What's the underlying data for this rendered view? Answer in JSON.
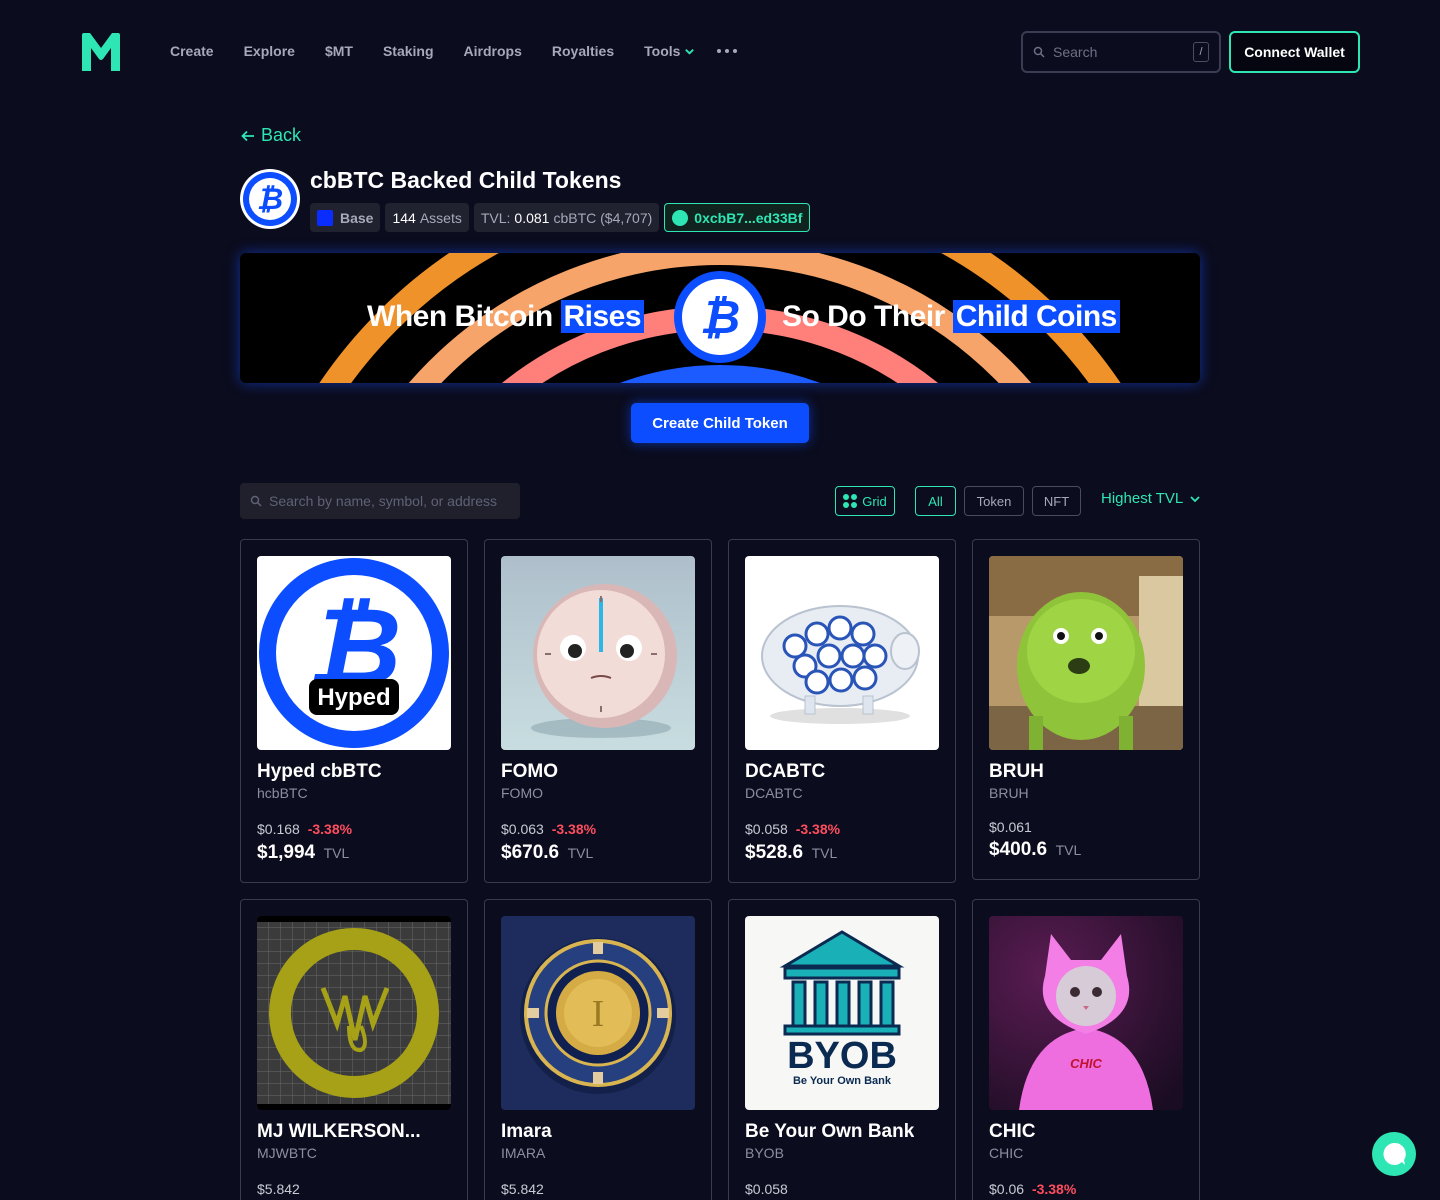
{
  "nav": {
    "items": [
      "Create",
      "Explore",
      "$MT",
      "Staking",
      "Airdrops",
      "Royalties"
    ],
    "tools_label": "Tools"
  },
  "search": {
    "placeholder": "Search",
    "shortcut": "/"
  },
  "connect_label": "Connect Wallet",
  "back_label": "Back",
  "collection": {
    "title": "cbBTC Backed Child Tokens",
    "chain": "Base",
    "assets_count": "144",
    "assets_label": "Assets",
    "tvl_label": "TVL:",
    "tvl_value": "0.081",
    "tvl_unit": "cbBTC ($4,707)",
    "address": "0xcbB7...ed33Bf"
  },
  "banner": {
    "left_plain": "When Bitcoin",
    "left_highlight": "Rises",
    "right_plain": "So Do Their",
    "right_highlight": "Child Coins"
  },
  "create_label": "Create Child Token",
  "filters": {
    "search_placeholder": "Search by name, symbol, or address",
    "grid_label": "Grid",
    "all_label": "All",
    "token_label": "Token",
    "nft_label": "NFT",
    "sort_label": "Highest TVL"
  },
  "tokens": [
    {
      "name": "Hyped cbBTC",
      "symbol": "hcbBTC",
      "price": "$0.168",
      "change": "-3.38%",
      "tvl": "$1,994",
      "tvl_label": "TVL",
      "thumb_text": "Hyped"
    },
    {
      "name": "FOMO",
      "symbol": "FOMO",
      "price": "$0.063",
      "change": "-3.38%",
      "tvl": "$670.6",
      "tvl_label": "TVL"
    },
    {
      "name": "DCABTC",
      "symbol": "DCABTC",
      "price": "$0.058",
      "change": "-3.38%",
      "tvl": "$528.6",
      "tvl_label": "TVL"
    },
    {
      "name": "BRUH",
      "symbol": "BRUH",
      "price": "$0.061",
      "change": "",
      "tvl": "$400.6",
      "tvl_label": "TVL"
    },
    {
      "name": "MJ WILKERSON...",
      "symbol": "MJWBTC",
      "price": "$5.842",
      "change": ""
    },
    {
      "name": "Imara",
      "symbol": "IMARA",
      "price": "$5.842",
      "change": "",
      "thumb_text": "I"
    },
    {
      "name": "Be Your Own Bank",
      "symbol": "BYOB",
      "price": "$0.058",
      "change": "",
      "thumb_text": "BYOB",
      "thumb_subtext": "Be Your Own Bank"
    },
    {
      "name": "CHIC",
      "symbol": "CHIC",
      "price": "$0.06",
      "change": "-3.38%",
      "thumb_text": "CHIC"
    }
  ]
}
